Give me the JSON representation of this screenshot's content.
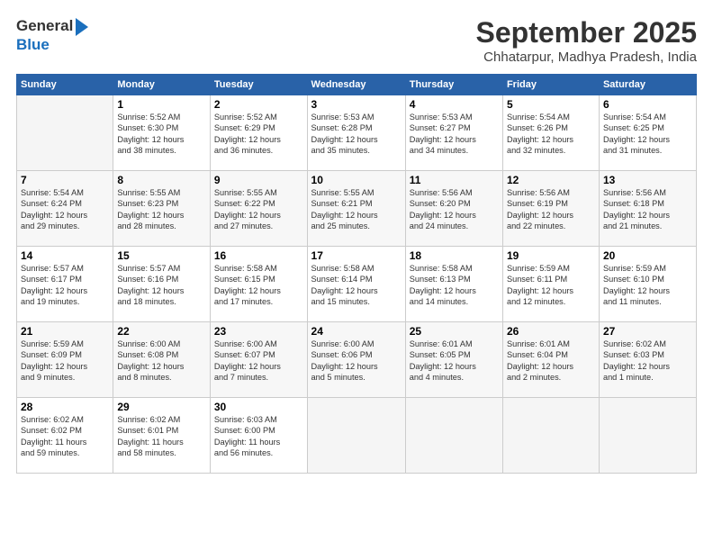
{
  "logo": {
    "general": "General",
    "blue": "Blue"
  },
  "title": {
    "month_year": "September 2025",
    "location": "Chhatarpur, Madhya Pradesh, India"
  },
  "headers": [
    "Sunday",
    "Monday",
    "Tuesday",
    "Wednesday",
    "Thursday",
    "Friday",
    "Saturday"
  ],
  "weeks": [
    [
      {
        "day": "",
        "info": ""
      },
      {
        "day": "1",
        "info": "Sunrise: 5:52 AM\nSunset: 6:30 PM\nDaylight: 12 hours\nand 38 minutes."
      },
      {
        "day": "2",
        "info": "Sunrise: 5:52 AM\nSunset: 6:29 PM\nDaylight: 12 hours\nand 36 minutes."
      },
      {
        "day": "3",
        "info": "Sunrise: 5:53 AM\nSunset: 6:28 PM\nDaylight: 12 hours\nand 35 minutes."
      },
      {
        "day": "4",
        "info": "Sunrise: 5:53 AM\nSunset: 6:27 PM\nDaylight: 12 hours\nand 34 minutes."
      },
      {
        "day": "5",
        "info": "Sunrise: 5:54 AM\nSunset: 6:26 PM\nDaylight: 12 hours\nand 32 minutes."
      },
      {
        "day": "6",
        "info": "Sunrise: 5:54 AM\nSunset: 6:25 PM\nDaylight: 12 hours\nand 31 minutes."
      }
    ],
    [
      {
        "day": "7",
        "info": "Sunrise: 5:54 AM\nSunset: 6:24 PM\nDaylight: 12 hours\nand 29 minutes."
      },
      {
        "day": "8",
        "info": "Sunrise: 5:55 AM\nSunset: 6:23 PM\nDaylight: 12 hours\nand 28 minutes."
      },
      {
        "day": "9",
        "info": "Sunrise: 5:55 AM\nSunset: 6:22 PM\nDaylight: 12 hours\nand 27 minutes."
      },
      {
        "day": "10",
        "info": "Sunrise: 5:55 AM\nSunset: 6:21 PM\nDaylight: 12 hours\nand 25 minutes."
      },
      {
        "day": "11",
        "info": "Sunrise: 5:56 AM\nSunset: 6:20 PM\nDaylight: 12 hours\nand 24 minutes."
      },
      {
        "day": "12",
        "info": "Sunrise: 5:56 AM\nSunset: 6:19 PM\nDaylight: 12 hours\nand 22 minutes."
      },
      {
        "day": "13",
        "info": "Sunrise: 5:56 AM\nSunset: 6:18 PM\nDaylight: 12 hours\nand 21 minutes."
      }
    ],
    [
      {
        "day": "14",
        "info": "Sunrise: 5:57 AM\nSunset: 6:17 PM\nDaylight: 12 hours\nand 19 minutes."
      },
      {
        "day": "15",
        "info": "Sunrise: 5:57 AM\nSunset: 6:16 PM\nDaylight: 12 hours\nand 18 minutes."
      },
      {
        "day": "16",
        "info": "Sunrise: 5:58 AM\nSunset: 6:15 PM\nDaylight: 12 hours\nand 17 minutes."
      },
      {
        "day": "17",
        "info": "Sunrise: 5:58 AM\nSunset: 6:14 PM\nDaylight: 12 hours\nand 15 minutes."
      },
      {
        "day": "18",
        "info": "Sunrise: 5:58 AM\nSunset: 6:13 PM\nDaylight: 12 hours\nand 14 minutes."
      },
      {
        "day": "19",
        "info": "Sunrise: 5:59 AM\nSunset: 6:11 PM\nDaylight: 12 hours\nand 12 minutes."
      },
      {
        "day": "20",
        "info": "Sunrise: 5:59 AM\nSunset: 6:10 PM\nDaylight: 12 hours\nand 11 minutes."
      }
    ],
    [
      {
        "day": "21",
        "info": "Sunrise: 5:59 AM\nSunset: 6:09 PM\nDaylight: 12 hours\nand 9 minutes."
      },
      {
        "day": "22",
        "info": "Sunrise: 6:00 AM\nSunset: 6:08 PM\nDaylight: 12 hours\nand 8 minutes."
      },
      {
        "day": "23",
        "info": "Sunrise: 6:00 AM\nSunset: 6:07 PM\nDaylight: 12 hours\nand 7 minutes."
      },
      {
        "day": "24",
        "info": "Sunrise: 6:00 AM\nSunset: 6:06 PM\nDaylight: 12 hours\nand 5 minutes."
      },
      {
        "day": "25",
        "info": "Sunrise: 6:01 AM\nSunset: 6:05 PM\nDaylight: 12 hours\nand 4 minutes."
      },
      {
        "day": "26",
        "info": "Sunrise: 6:01 AM\nSunset: 6:04 PM\nDaylight: 12 hours\nand 2 minutes."
      },
      {
        "day": "27",
        "info": "Sunrise: 6:02 AM\nSunset: 6:03 PM\nDaylight: 12 hours\nand 1 minute."
      }
    ],
    [
      {
        "day": "28",
        "info": "Sunrise: 6:02 AM\nSunset: 6:02 PM\nDaylight: 11 hours\nand 59 minutes."
      },
      {
        "day": "29",
        "info": "Sunrise: 6:02 AM\nSunset: 6:01 PM\nDaylight: 11 hours\nand 58 minutes."
      },
      {
        "day": "30",
        "info": "Sunrise: 6:03 AM\nSunset: 6:00 PM\nDaylight: 11 hours\nand 56 minutes."
      },
      {
        "day": "",
        "info": ""
      },
      {
        "day": "",
        "info": ""
      },
      {
        "day": "",
        "info": ""
      },
      {
        "day": "",
        "info": ""
      }
    ]
  ]
}
